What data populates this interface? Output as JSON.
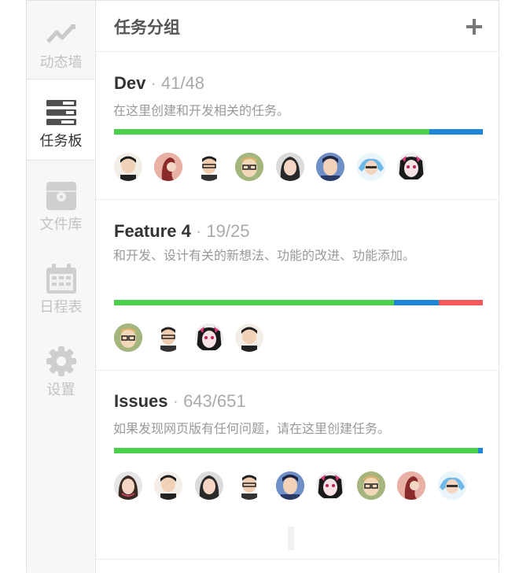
{
  "sidebar": {
    "items": [
      {
        "label": "动态墙",
        "icon": "activity-icon",
        "active": false
      },
      {
        "label": "任务板",
        "icon": "taskboard-icon",
        "active": true
      },
      {
        "label": "文件库",
        "icon": "folder-icon",
        "active": false
      },
      {
        "label": "日程表",
        "icon": "calendar-icon",
        "active": false
      },
      {
        "label": "设置",
        "icon": "gear-icon",
        "active": false
      }
    ]
  },
  "header": {
    "title": "任务分组",
    "add_icon": "plus-icon"
  },
  "groups": [
    {
      "name": "Dev",
      "sep": " · ",
      "count": "41/48",
      "description": "在这里创建和开发相关的任务。",
      "progress": [
        {
          "color": "#4cd14c",
          "fraction": 0.855
        },
        {
          "color": "#1e86d6",
          "fraction": 0.145
        }
      ],
      "avatars": 8
    },
    {
      "name": "Feature 4",
      "sep": " · ",
      "count": "19/25",
      "description": "和开发、设计有关的新想法、功能的改进、功能添加。",
      "progress": [
        {
          "color": "#4cd14c",
          "fraction": 0.76
        },
        {
          "color": "#1e86d6",
          "fraction": 0.12
        },
        {
          "color": "#f25a5a",
          "fraction": 0.12
        }
      ],
      "avatars": 4
    },
    {
      "name": "Issues",
      "sep": " · ",
      "count": "643/651",
      "description": "如果发现网页版有任何问题，请在这里创建任务。",
      "progress": [
        {
          "color": "#4cd14c",
          "fraction": 0.988
        },
        {
          "color": "#1e86d6",
          "fraction": 0.012
        }
      ],
      "avatars": 9
    }
  ]
}
